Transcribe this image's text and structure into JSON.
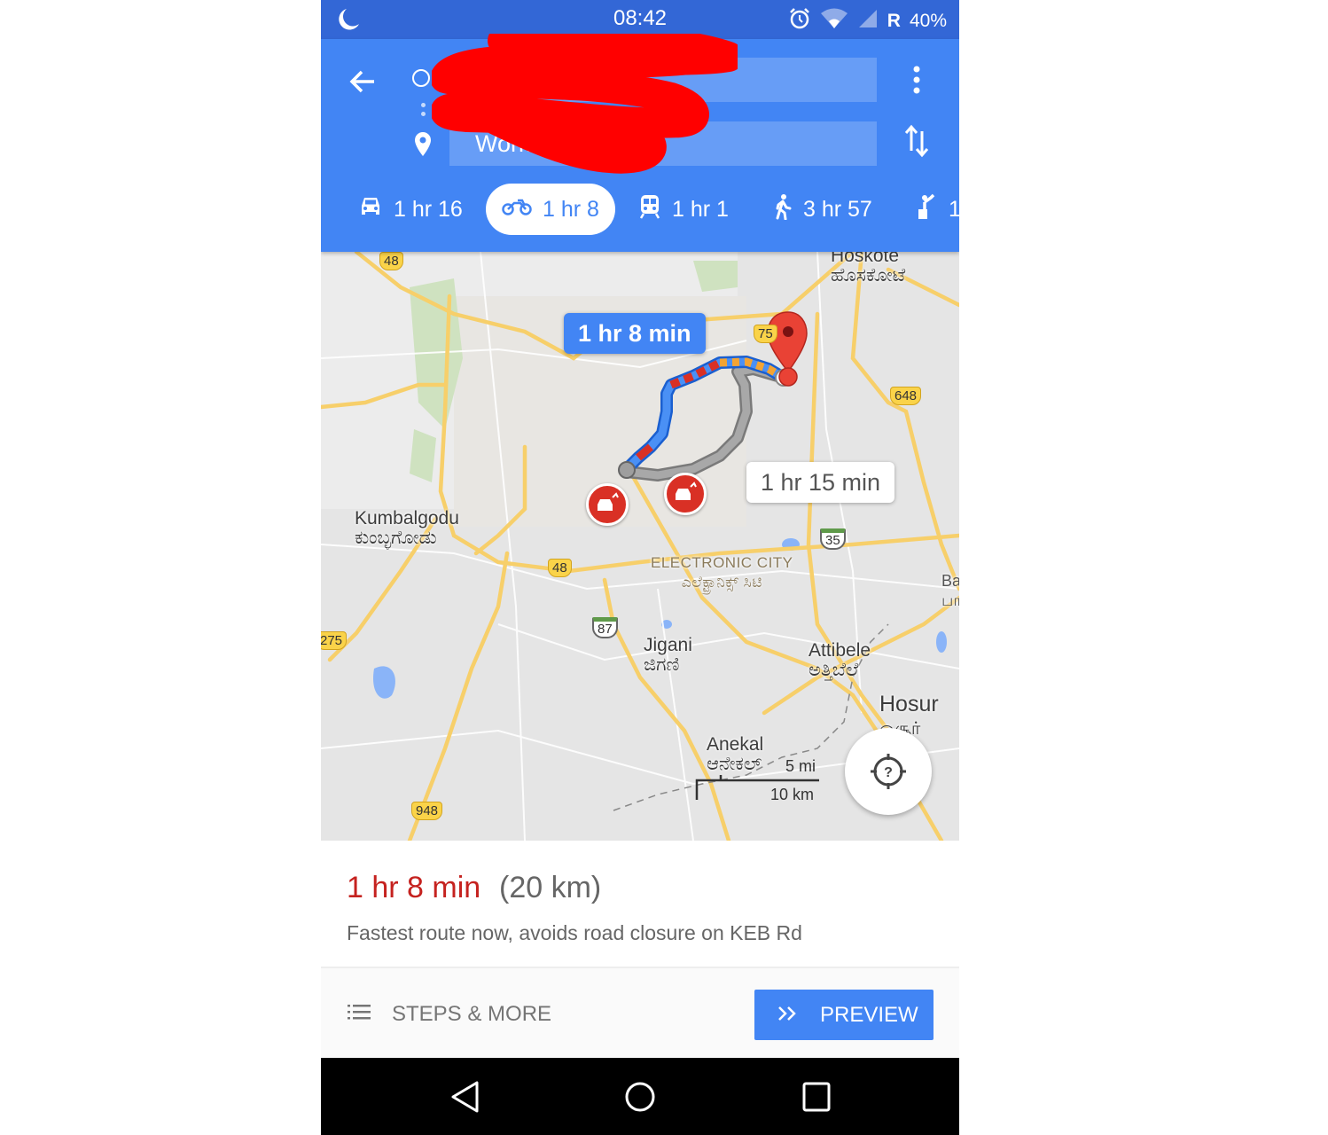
{
  "status_bar": {
    "time": "08:42",
    "network_label": "R",
    "battery": "40%",
    "icons": [
      "do-not-disturb-moon-icon",
      "alarm-icon",
      "wifi-icon",
      "cell-signal-icon"
    ]
  },
  "directions": {
    "origin_value": "",
    "origin_redacted": true,
    "destination_value": "Work",
    "icons": {
      "back": "back-arrow-icon",
      "origin": "origin-circle-icon",
      "destination": "destination-pin-icon",
      "more": "more-vert-icon",
      "swap": "swap-icon"
    }
  },
  "travel_modes": [
    {
      "mode": "drive",
      "icon": "car-icon",
      "label": "1 hr 16",
      "active": false
    },
    {
      "mode": "two-wheeler",
      "icon": "motorcycle-icon",
      "label": "1 hr 8",
      "active": true
    },
    {
      "mode": "transit",
      "icon": "train-icon",
      "label": "1 hr 1",
      "active": false
    },
    {
      "mode": "walk",
      "icon": "walk-icon",
      "label": "3 hr 57",
      "active": false
    },
    {
      "mode": "ride",
      "icon": "ride-hail-icon",
      "label": "1",
      "active": false
    }
  ],
  "map": {
    "primary_route_callout": "1 hr 8 min",
    "alternate_route_callout": "1 hr 15 min",
    "places": [
      {
        "name": "Hoskote",
        "local": "ಹೊಸಕೋಟೆ"
      },
      {
        "name": "Kumbalgodu",
        "local": "ಕುಂಬ್ಳಗೋಡು"
      },
      {
        "name": "ELECTRONIC CITY",
        "local": "ಎಲೆಕ್ಟ್ರಾನಿಕ್ಸ್ ಸಿಟಿ"
      },
      {
        "name": "Jigani",
        "local": "ಜಿಗಣಿ"
      },
      {
        "name": "Attibele",
        "local": "ಅತ್ತಿಬೆಲೆ"
      },
      {
        "name": "Hosur",
        "local": "ஓசூர்"
      },
      {
        "name": "Anekal",
        "local": "ಆನೇಕಲ್"
      },
      {
        "name": "Ba",
        "local": "பா"
      }
    ],
    "road_shields": [
      "48",
      "75",
      "648",
      "35",
      "48",
      "87",
      "275",
      "948"
    ],
    "scale": {
      "imperial": "5 mi",
      "metric": "10 km"
    },
    "colors": {
      "route_primary": "#4285f4",
      "route_alt": "#9e9e9e",
      "traffic_slow": "#f4a433",
      "traffic_heavy": "#d93025",
      "pin": "#e94235"
    }
  },
  "route_info": {
    "duration": "1 hr 8 min",
    "distance": "(20 km)",
    "description": "Fastest route now, avoids road closure on KEB Rd"
  },
  "actions": {
    "steps_label": "STEPS & MORE",
    "preview_label": "PREVIEW"
  },
  "nav_bar": [
    "back-icon",
    "home-icon",
    "recents-icon"
  ]
}
